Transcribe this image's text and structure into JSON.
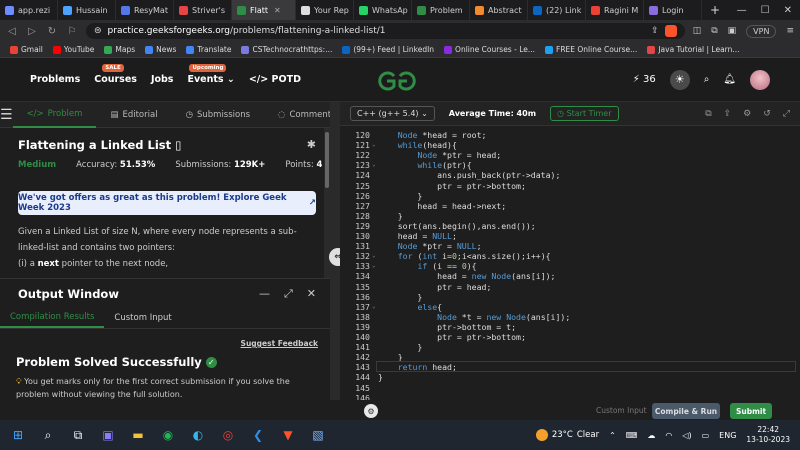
{
  "browser": {
    "tabs": [
      {
        "label": "app.rezi",
        "color": "#6c8cff"
      },
      {
        "label": "Hussain",
        "color": "#4da3ff"
      },
      {
        "label": "ResyMat",
        "color": "#5578e8"
      },
      {
        "label": "Striver's",
        "color": "#e64545"
      },
      {
        "label": "Flatt",
        "color": "#2f8d46",
        "active": true
      },
      {
        "label": "Your Rep",
        "color": "#dddddd"
      },
      {
        "label": "WhatsAp",
        "color": "#25d366"
      },
      {
        "label": "Problem",
        "color": "#2f8d46"
      },
      {
        "label": "Abstract",
        "color": "#f28b30"
      },
      {
        "label": "(22) Link",
        "color": "#0a66c2"
      },
      {
        "label": "Ragini M",
        "color": "#ea4335"
      },
      {
        "label": "Login",
        "color": "#8a6ce0"
      }
    ],
    "new_tab": "+",
    "url_host": "practice.geeksforgeeks.org",
    "url_path": "/problems/flattening-a-linked-list/1",
    "vpn": "VPN",
    "bookmarks": [
      "Gmail",
      "YouTube",
      "Maps",
      "News",
      "Translate",
      "CSTechnocrathttps:...",
      "(99+) Feed | LinkedIn",
      "Online Courses - Le...",
      "FREE Online Course...",
      "Java Tutorial | Learn..."
    ],
    "bookmark_colors": [
      "#ea4335",
      "#ff0000",
      "#34a853",
      "#4285f4",
      "#4285f4",
      "#7b7bdb",
      "#0a66c2",
      "#8a2be2",
      "#1da1f2",
      "#e64545"
    ]
  },
  "gfg": {
    "nav": {
      "problems": "Problems",
      "courses": "Courses",
      "sale_badge": "SALE",
      "jobs": "Jobs",
      "events": "Events",
      "upcoming_badge": "Upcoming",
      "potd": "POTD"
    },
    "streak": "36",
    "brand_color": "#2f8d46"
  },
  "left": {
    "tabs": {
      "problem": "Problem",
      "editorial": "Editorial",
      "submissions": "Submissions",
      "comments": "Comments"
    },
    "title": "Flattening a Linked List",
    "difficulty": "Medium",
    "accuracy_label": "Accuracy:",
    "accuracy": "51.53%",
    "submissions_label": "Submissions:",
    "submissions": "129K+",
    "points_label": "Points:",
    "points": "4",
    "offer": "We've got offers as great as this problem! Explore Geek Week 2023",
    "desc_line1": "Given a Linked List of size N, where every node represents a sub-",
    "desc_line2": "linked-list and contains two pointers:",
    "desc_line3_a": "(i) a ",
    "desc_line3_b": "next",
    "desc_line3_c": " pointer to the next node,"
  },
  "output": {
    "title": "Output Window",
    "tab_compile": "Compilation Results",
    "tab_custom": "Custom Input",
    "suggest": "Suggest Feedback",
    "success": "Problem Solved Successfully",
    "note": "You get marks only for the first correct submission if you solve the problem without viewing the full solution."
  },
  "editor": {
    "language": "C++ (g++ 5.4)",
    "avg_time": "Average Time: 40m",
    "timer": "Start Timer",
    "lines": [
      {
        "n": "120",
        "t": "    Node *head = root;"
      },
      {
        "n": "121",
        "t": "    while(head){"
      },
      {
        "n": "122",
        "t": "        Node *ptr = head;"
      },
      {
        "n": "123",
        "t": "        while(ptr){"
      },
      {
        "n": "124",
        "t": "            ans.push_back(ptr->data);"
      },
      {
        "n": "125",
        "t": "            ptr = ptr->bottom;"
      },
      {
        "n": "126",
        "t": "        }"
      },
      {
        "n": "127",
        "t": "        head = head->next;"
      },
      {
        "n": "128",
        "t": "    }"
      },
      {
        "n": "129",
        "t": "    sort(ans.begin(),ans.end());"
      },
      {
        "n": "130",
        "t": "    head = NULL;"
      },
      {
        "n": "131",
        "t": "    Node *ptr = NULL;"
      },
      {
        "n": "132",
        "t": "    for (int i=0;i<ans.size();i++){"
      },
      {
        "n": "133",
        "t": "        if (i == 0){"
      },
      {
        "n": "134",
        "t": "            head = new Node(ans[i]);"
      },
      {
        "n": "135",
        "t": "            ptr = head;"
      },
      {
        "n": "136",
        "t": "        }"
      },
      {
        "n": "137",
        "t": "        else{"
      },
      {
        "n": "138",
        "t": "            Node *t = new Node(ans[i]);"
      },
      {
        "n": "139",
        "t": "            ptr->bottom = t;"
      },
      {
        "n": "140",
        "t": "            ptr = ptr->bottom;"
      },
      {
        "n": "141",
        "t": "        }"
      },
      {
        "n": "142",
        "t": "    }"
      },
      {
        "n": "143",
        "t": "    return head;"
      },
      {
        "n": "144",
        "t": "}"
      },
      {
        "n": "145",
        "t": ""
      },
      {
        "n": "146",
        "t": ""
      }
    ],
    "custom_input": "Custom Input",
    "compile_run": "Compile & Run",
    "submit": "Submit"
  },
  "taskbar": {
    "temp": "23°C",
    "weather": "Clear",
    "lang": "ENG",
    "time": "22:42",
    "date": "13-10-2023"
  }
}
